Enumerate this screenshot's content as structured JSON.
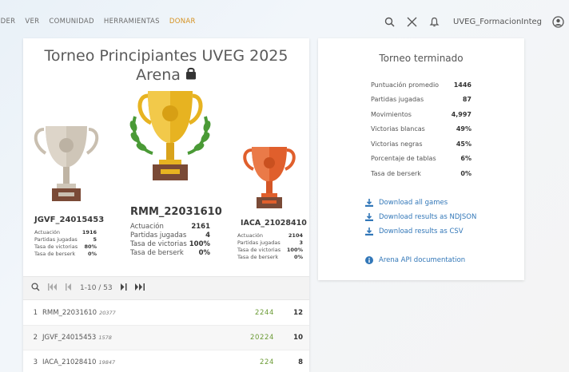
{
  "nav": {
    "items": [
      "NDER",
      "VER",
      "COMUNIDAD",
      "HERRAMIENTAS"
    ],
    "donate": "DONAR",
    "username": "UVEG_FormacionInteg"
  },
  "tournament": {
    "title_line1": "Torneo Principiantes UVEG 2025",
    "title_line2": "Arena"
  },
  "podium": [
    {
      "place": 2,
      "name": "JGVF_24015453",
      "stats": [
        {
          "k": "Actuación",
          "v": "1916"
        },
        {
          "k": "Partidas jugadas",
          "v": "5"
        },
        {
          "k": "Tasa de victorias",
          "v": "80%"
        },
        {
          "k": "Tasa de berserk",
          "v": "0%"
        }
      ]
    },
    {
      "place": 1,
      "name": "RMM_22031610",
      "stats": [
        {
          "k": "Actuación",
          "v": "2161"
        },
        {
          "k": "Partidas jugadas",
          "v": "4"
        },
        {
          "k": "Tasa de victorias",
          "v": "100%"
        },
        {
          "k": "Tasa de berserk",
          "v": "0%"
        }
      ]
    },
    {
      "place": 3,
      "name": "IACA_21028410",
      "stats": [
        {
          "k": "Actuación",
          "v": "2104"
        },
        {
          "k": "Partidas jugadas",
          "v": "3"
        },
        {
          "k": "Tasa de victorias",
          "v": "100%"
        },
        {
          "k": "Tasa de berserk",
          "v": "0%"
        }
      ]
    }
  ],
  "pager": {
    "range": "1-10 / 53"
  },
  "standings": [
    {
      "rank": "1",
      "name": "RMM_22031610",
      "rating": "20377",
      "sheet": "2244",
      "score": "12"
    },
    {
      "rank": "2",
      "name": "JGVF_24015453",
      "rating": "1578",
      "sheet": "20224",
      "score": "10"
    },
    {
      "rank": "3",
      "name": "IACA_21028410",
      "rating": "19847",
      "sheet": "224",
      "score": "8"
    }
  ],
  "summary": {
    "title": "Torneo terminado",
    "rows": [
      {
        "k": "Puntuación promedio",
        "v": "1446"
      },
      {
        "k": "Partidas jugadas",
        "v": "87"
      },
      {
        "k": "Movimientos",
        "v": "4,997"
      },
      {
        "k": "Victorias blancas",
        "v": "49%"
      },
      {
        "k": "Victorias negras",
        "v": "45%"
      },
      {
        "k": "Porcentaje de tablas",
        "v": "6%"
      },
      {
        "k": "Tasa de berserk",
        "v": "0%"
      }
    ],
    "links": {
      "download_games": "Download all games",
      "download_ndjson": "Download results as NDJSON",
      "download_csv": "Download results as CSV",
      "api_docs": "Arena API documentation"
    }
  },
  "colors": {
    "gold": "#e7b321",
    "silver": "#c9bfb0",
    "bronze": "#e05f2c",
    "link": "#3277b8",
    "donate": "#d59120",
    "sheet": "#6a9a34"
  }
}
